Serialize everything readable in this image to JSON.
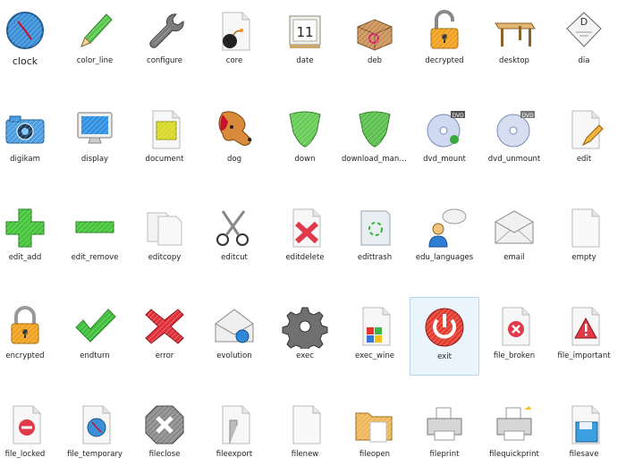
{
  "icons": [
    {
      "label": "clock",
      "icon": "clock-icon"
    },
    {
      "label": "color_line",
      "icon": "pencil-icon"
    },
    {
      "label": "configure",
      "icon": "wrench-icon"
    },
    {
      "label": "core",
      "icon": "bomb-file-icon"
    },
    {
      "label": "date",
      "icon": "calendar-icon"
    },
    {
      "label": "deb",
      "icon": "package-box-icon"
    },
    {
      "label": "decrypted",
      "icon": "unlocked-padlock-icon"
    },
    {
      "label": "desktop",
      "icon": "table-icon"
    },
    {
      "label": "dia",
      "icon": "diagram-icon"
    },
    {
      "label": "digikam",
      "icon": "camera-icon"
    },
    {
      "label": "display",
      "icon": "monitor-icon"
    },
    {
      "label": "document",
      "icon": "document-icon"
    },
    {
      "label": "dog",
      "icon": "dog-icon"
    },
    {
      "label": "down",
      "icon": "down-shield-icon"
    },
    {
      "label": "download_mana...",
      "icon": "download-shield-icon"
    },
    {
      "label": "dvd_mount",
      "icon": "dvd-mount-icon"
    },
    {
      "label": "dvd_unmount",
      "icon": "dvd-unmount-icon"
    },
    {
      "label": "edit",
      "icon": "edit-pencil-icon"
    },
    {
      "label": "edit_add",
      "icon": "plus-icon"
    },
    {
      "label": "edit_remove",
      "icon": "minus-icon"
    },
    {
      "label": "editcopy",
      "icon": "copy-icon"
    },
    {
      "label": "editcut",
      "icon": "scissors-icon"
    },
    {
      "label": "editdelete",
      "icon": "delete-file-icon"
    },
    {
      "label": "edittrash",
      "icon": "trash-icon"
    },
    {
      "label": "edu_languages",
      "icon": "person-speech-icon"
    },
    {
      "label": "email",
      "icon": "envelope-icon"
    },
    {
      "label": "empty",
      "icon": "empty-file-icon"
    },
    {
      "label": "encrypted",
      "icon": "locked-padlock-icon"
    },
    {
      "label": "endturn",
      "icon": "checkmark-icon"
    },
    {
      "label": "error",
      "icon": "error-x-icon"
    },
    {
      "label": "evolution",
      "icon": "evolution-mail-icon"
    },
    {
      "label": "exec",
      "icon": "gear-icon"
    },
    {
      "label": "exec_wine",
      "icon": "wine-file-icon"
    },
    {
      "label": "exit",
      "icon": "power-icon"
    },
    {
      "label": "file_broken",
      "icon": "broken-file-icon"
    },
    {
      "label": "file_important",
      "icon": "important-file-icon"
    },
    {
      "label": "file_locked",
      "icon": "locked-file-icon"
    },
    {
      "label": "file_temporary",
      "icon": "temporary-file-icon"
    },
    {
      "label": "fileclose",
      "icon": "close-octagon-icon"
    },
    {
      "label": "fileexport",
      "icon": "export-file-icon"
    },
    {
      "label": "filenew",
      "icon": "new-file-icon"
    },
    {
      "label": "fileopen",
      "icon": "folder-open-icon"
    },
    {
      "label": "fileprint",
      "icon": "printer-icon"
    },
    {
      "label": "filequickprint",
      "icon": "quick-printer-icon"
    },
    {
      "label": "filesave",
      "icon": "floppy-icon"
    }
  ],
  "selected_index": 33
}
